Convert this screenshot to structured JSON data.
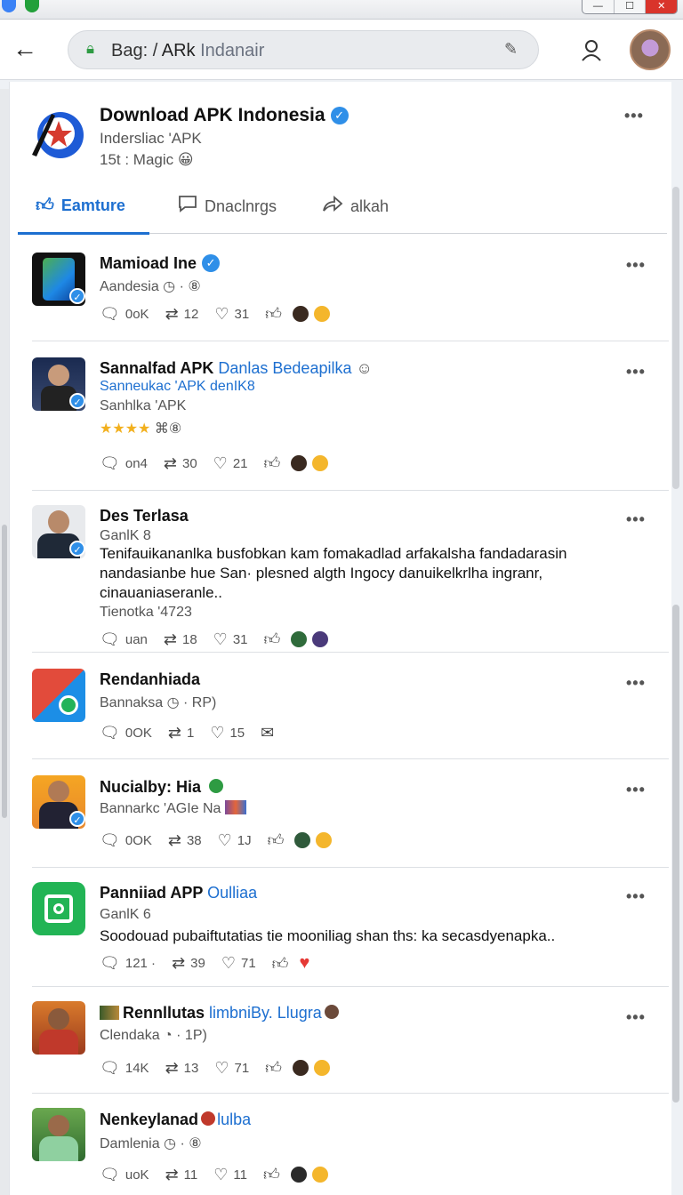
{
  "window": {
    "controls": [
      "—",
      "☐",
      "✕"
    ]
  },
  "browser": {
    "url_prefix": "Bag:",
    "url_sep": " / ",
    "url_bold": "ARk",
    "url_rest": " Indanair"
  },
  "profile": {
    "name": "Download APK Indonesia",
    "handle": "Indersliac 'APK",
    "meta": "15t : Magic 😀"
  },
  "tabs": [
    {
      "label": "Eamture"
    },
    {
      "label": "Dnaclnrgs"
    },
    {
      "label": "alkah"
    }
  ],
  "posts": [
    {
      "title": "Mamioad Ine",
      "line1": "Aandesia  ◷ · ⑧",
      "replies": "0oK",
      "reposts": "12",
      "likes": "31"
    },
    {
      "title": "Sannalfad APK",
      "title_blue": "Danlas Bedeapilka",
      "line1": "Sanneukac 'APK  denIK8",
      "line2": "Sanhlka 'APK",
      "stars": "★★★★",
      "stars_extra": " ⌘⑧",
      "replies": "on4",
      "reposts": "30",
      "likes": "21"
    },
    {
      "title": "Des Terlasa",
      "line1": "GanlK 8",
      "body": "Tenifauikananlka busfobkan kam fomakadlad arfakalsha fandadarasin nandasianbe hue San· plesned algth Ingocy danuikelkrlha ingranr, cinauaniaseranle..",
      "line2": "Tienotka '4723",
      "replies": "uan",
      "reposts": "18",
      "likes": "31"
    },
    {
      "title": "Rendanhiada",
      "line1": "Bannaksa ◷ · RP)",
      "replies": "0OK",
      "reposts": "1",
      "likes": "15"
    },
    {
      "title": "Nucialby: Hia",
      "line1": "Bannarkc 'AGIe Na",
      "replies": "0OK",
      "reposts": "38",
      "likes": "1J"
    },
    {
      "title": "Panniiad APP",
      "title_blue": "Oulliaa",
      "line1": "GanlK 6",
      "body": "Soodouad pubaiftutatias tie mooniliag shan ths: ka secasdyenapka..",
      "replies": "121 ·",
      "reposts": "39",
      "likes": "71"
    },
    {
      "title": "Rennllutas",
      "title_blue": "limbniBy. Llugra",
      "line1": "Clendaka  ◔ · 1P)",
      "replies": "14K",
      "reposts": "13",
      "likes": "71"
    },
    {
      "title": "Nenkeylanad",
      "title_blue": "lulba",
      "line1": "Damlenia  ◷ · ⑧",
      "replies": "uoK",
      "reposts": "11",
      "likes": "11"
    }
  ],
  "colors": {
    "accent": "#1d6fd0",
    "verified": "#2f8fe8",
    "star": "#f2b01e"
  }
}
